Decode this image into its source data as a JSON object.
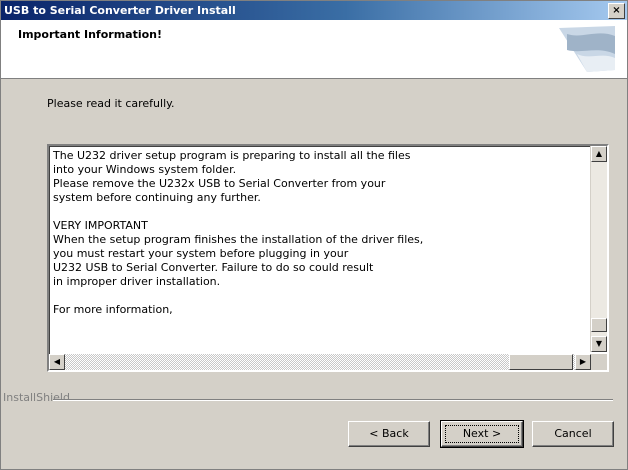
{
  "window": {
    "title": "USB to Serial Converter Driver Install",
    "close_glyph": "×"
  },
  "header": {
    "title": "Important Information!"
  },
  "prompt": "Please read it carefully.",
  "message": {
    "text": "The U232 driver setup program is preparing to install all the files\ninto your Windows system folder.\nPlease remove the U232x USB to Serial Converter from your\nsystem before continuing any further.\n\nVERY IMPORTANT\nWhen the setup program finishes the installation of the driver files,\nyou must restart your system before plugging in your\nU232 USB to Serial Converter. Failure to do so could result\nin improper driver installation.\n\nFor more information,"
  },
  "installshield_label": "InstallShield",
  "buttons": {
    "back": "< Back",
    "next": "Next >",
    "cancel": "Cancel"
  },
  "colors": {
    "titlebar_start": "#0a246a",
    "titlebar_end": "#a6caf0",
    "dialog_bg": "#d4d0c8"
  }
}
